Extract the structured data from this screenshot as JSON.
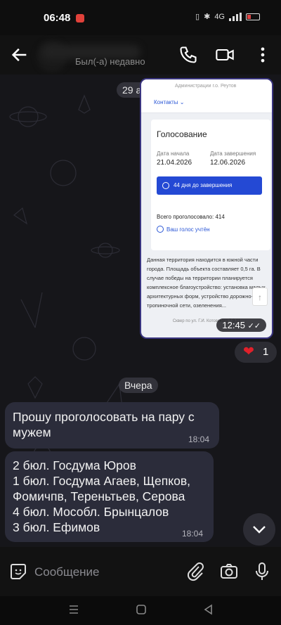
{
  "status_bar": {
    "time": "06:48",
    "network": "4G",
    "signal_icon": "signal-icon",
    "battery_icon": "battery-low-icon"
  },
  "header": {
    "contact_status": "Был(-а) недавно"
  },
  "chat": {
    "date_sep_1": "29 апр.",
    "date_sep_2": "Вчера",
    "media": {
      "admin_line": "Администрации г.о. Реутов",
      "contacts_link": "Контакты",
      "card_title": "Голосование",
      "start_label": "Дата начала",
      "start_value": "21.04.2026",
      "end_label": "Дата завершения",
      "end_value": "12.06.2026",
      "days_button": "44 дня до завершения",
      "total_voted": "Всего проголосовало: 414",
      "your_vote": "Ваш голос учтён",
      "description": "Данная территория находится в южной части города. Площадь объекта составляет 0,5 га. В случае победы на территории планируется комплексное благоустройство: установка малых архитектурных форм, устройство дорожно-тропиночной сети, озеленения...",
      "caption": "Сквер по ул. Г.И. Котовского 7,9,11",
      "time": "12:45"
    },
    "reaction": {
      "emoji": "❤",
      "count": "1"
    },
    "messages": [
      {
        "text": "Прошу проголосовать на пару с\nмужем",
        "time": "18:04"
      },
      {
        "text": "2 бюл. Госдума Юров\n1 бюл. Госдума Агаев, Щепков,\nФомичпв, Тереньтьев, Серова\n4 бюл. Мособл. Брынцалов\n3 бюл. Ефимов",
        "time": "18:04"
      }
    ]
  },
  "composer": {
    "placeholder": "Сообщение"
  },
  "colors": {
    "chat_bg": "#16161a",
    "bubble_bg": "#2b2c3a",
    "accent_blue": "#2449d4",
    "heart_red": "#e0202a"
  }
}
